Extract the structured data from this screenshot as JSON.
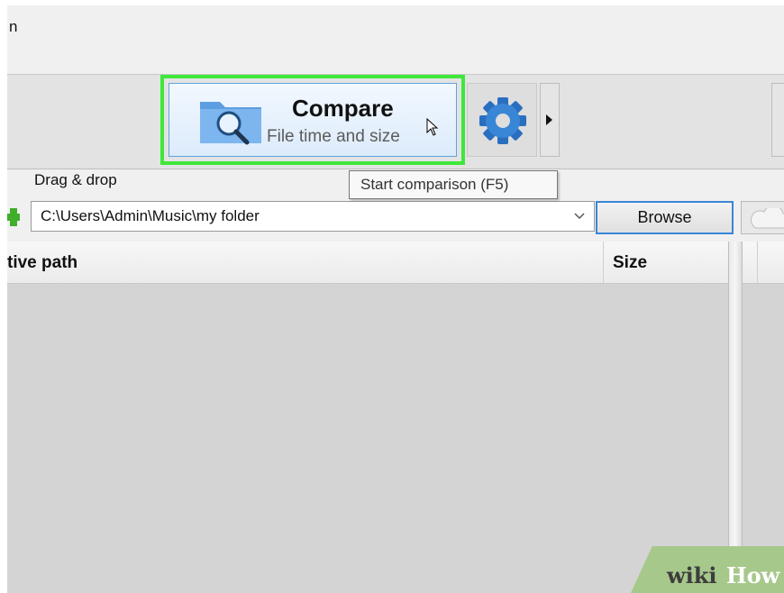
{
  "window": {
    "title_fragment": "n"
  },
  "toolbar": {
    "compare_button": {
      "title": "Compare",
      "subtitle": "File time and size",
      "icon": "folder-search-icon",
      "highlight_color": "#3ee83a"
    },
    "settings_icon": "gear-icon",
    "expand_icon": "triangle-right-icon"
  },
  "tooltip": {
    "text": "Start comparison (F5)"
  },
  "folder_pane": {
    "drag_drop_label": "Drag & drop",
    "path_value": "C:\\Users\\Admin\\Music\\my folder",
    "browse_label": "Browse",
    "cloud_icon": "cloud-icon"
  },
  "file_grid": {
    "columns": [
      "tive path",
      "Size"
    ]
  },
  "watermark": {
    "wiki": "wiki",
    "how": "How"
  }
}
